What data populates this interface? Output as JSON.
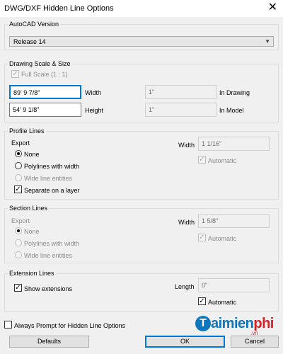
{
  "window": {
    "title": "DWG/DXF Hidden Line Options",
    "close_glyph": "✕"
  },
  "autocad_version": {
    "label": "AutoCAD Version",
    "selected": "Release 14"
  },
  "drawing_scale": {
    "label": "Drawing Scale & Size",
    "full_scale_label": "Full Scale (1 : 1)",
    "full_scale_checked": true,
    "width_value": "89' 9 7/8\"",
    "width_label": "Width",
    "height_value": "54' 9 1/8\"",
    "height_label": "Height",
    "drawing_value": "1\"",
    "drawing_label": "In Drawing",
    "model_value": "1\"",
    "model_label": "In Model"
  },
  "profile_lines": {
    "label": "Profile Lines",
    "export_label": "Export",
    "options": [
      "None",
      "Polylines with width",
      "Wide line entities"
    ],
    "selected_index": 0,
    "separate_layer_label": "Separate on a layer",
    "separate_layer_checked": true,
    "width_label": "Width",
    "width_value": "1 1/16\"",
    "automatic_label": "Automatic",
    "automatic_checked": true
  },
  "section_lines": {
    "label": "Section Lines",
    "export_label": "Export",
    "options": [
      "None",
      "Polylines with width",
      "Wide line entities"
    ],
    "selected_index": 0,
    "width_label": "Width",
    "width_value": "1 5/8\"",
    "automatic_label": "Automatic",
    "automatic_checked": true
  },
  "extension_lines": {
    "label": "Extension Lines",
    "show_label": "Show extensions",
    "show_checked": true,
    "length_label": "Length",
    "length_value": "0\"",
    "automatic_label": "Automatic",
    "automatic_checked": true
  },
  "footer": {
    "always_prompt_label": "Always Prompt for Hidden Line Options",
    "always_prompt_checked": false,
    "defaults_label": "Defaults",
    "ok_label": "OK",
    "cancel_label": "Cancel"
  },
  "watermark": {
    "brand_t": "T",
    "brand_main": "aimien",
    "brand_red": "phi",
    "brand_domain": ".vn",
    "brand_color": "#0e76bd",
    "accent_color": "#d62128"
  }
}
